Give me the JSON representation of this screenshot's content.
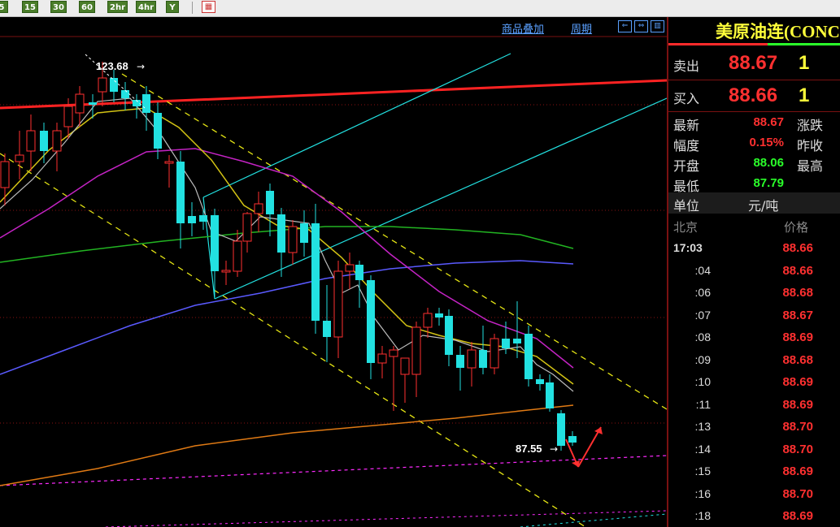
{
  "toolbar": {
    "periods": [
      "5",
      "15",
      "30",
      "60",
      "2hr",
      "4hr",
      "Y"
    ],
    "calendar_icon": "calendar-icon"
  },
  "chart": {
    "links": {
      "overlay": "商品叠加",
      "period": "周期"
    },
    "nav_icons": [
      "scroll-left-icon",
      "scroll-both-icon",
      "panel-toggle-icon"
    ],
    "annotations": {
      "high": "123.68",
      "low": "87.55"
    }
  },
  "chart_data": {
    "type": "candlestick",
    "high_label": "123.68",
    "low_label": "87.55",
    "moving_averages": [
      "#bbbbbb",
      "#d4c414",
      "#c423c4",
      "#22b422",
      "#5a5aff",
      "#e07a14"
    ],
    "candle_colors": {
      "up": "#ff3030",
      "down": "#22e1e1"
    }
  },
  "quote": {
    "title": "美原油连(CONC",
    "sell": {
      "label": "卖出",
      "price": "88.67",
      "qty": "1"
    },
    "buy": {
      "label": "买入",
      "price": "88.66",
      "qty": "1"
    },
    "stats": [
      {
        "label": "最新",
        "value": "88.67",
        "color": "red",
        "label2": "涨跌"
      },
      {
        "label": "幅度",
        "value": "0.15%",
        "color": "red",
        "label2": "昨收"
      },
      {
        "label": "开盘",
        "value": "88.06",
        "color": "green",
        "label2": "最高"
      },
      {
        "label": "最低",
        "value": "87.79",
        "color": "green",
        "label2": ""
      }
    ],
    "unit": {
      "label": "单位",
      "value": "元/吨"
    },
    "ticks_header": {
      "time": "北京",
      "price": "价格"
    },
    "ticks": [
      {
        "time": "17:03",
        "price": "88.66"
      },
      {
        "time": ":04",
        "price": "88.66"
      },
      {
        "time": ":06",
        "price": "88.68"
      },
      {
        "time": ":07",
        "price": "88.67"
      },
      {
        "time": ":08",
        "price": "88.69"
      },
      {
        "time": ":09",
        "price": "88.68"
      },
      {
        "time": ":10",
        "price": "88.69"
      },
      {
        "time": ":11",
        "price": "88.69"
      },
      {
        "time": ":13",
        "price": "88.70"
      },
      {
        "time": ":14",
        "price": "88.70"
      },
      {
        "time": ":15",
        "price": "88.69"
      },
      {
        "time": ":16",
        "price": "88.70"
      },
      {
        "time": ":18",
        "price": "88.69"
      }
    ]
  }
}
